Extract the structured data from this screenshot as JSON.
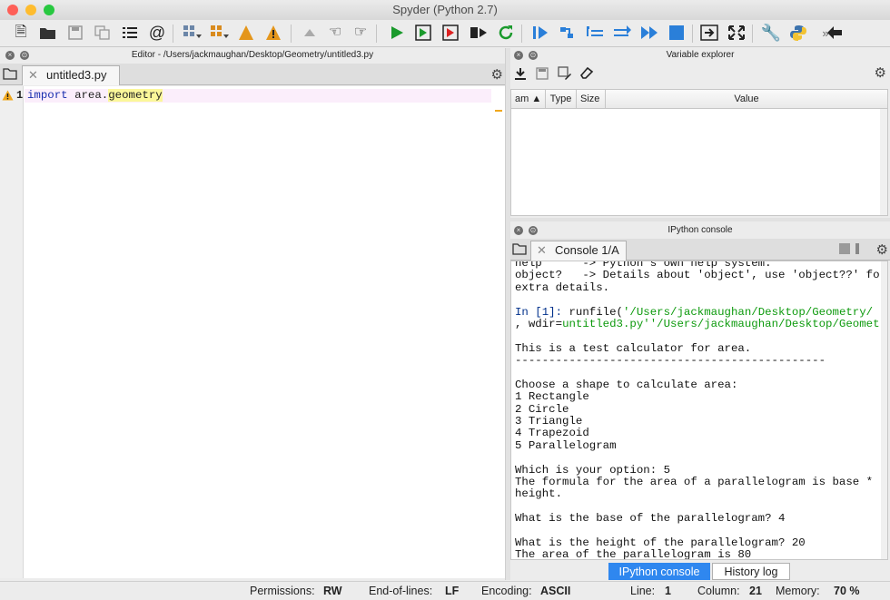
{
  "window": {
    "title": "Spyder (Python 2.7)"
  },
  "colors": {
    "close": "#fe5f57",
    "minimize": "#febc2e",
    "zoom": "#28c840",
    "tab_active": "#2f87ef"
  },
  "toolbar": {
    "icons": [
      "new-file-icon",
      "open-file-icon",
      "save-icon",
      "save-all-icon",
      "outline-icon",
      "at-icon",
      "cell-icon",
      "cell-run-icon",
      "warning-icon",
      "maximize-icon",
      "run-icon",
      "run-cell-icon",
      "run-cell-advance-icon",
      "run-selection-icon",
      "rerun-icon",
      "debug-icon",
      "step-icon",
      "step-into-icon",
      "step-return-icon",
      "continue-icon",
      "stop-icon",
      "pane-icon",
      "fullscreen-icon",
      "wrench-icon",
      "python-icon",
      "back-icon"
    ]
  },
  "editor": {
    "header": "Editor - /Users/jackmaughan/Desktop/Geometry/untitled3.py",
    "tab_label": "untitled3.py",
    "line_number": "1",
    "code_keyword": "import",
    "code_module": "area.",
    "code_highlight": "geometry"
  },
  "variable_explorer": {
    "header": "Variable explorer",
    "columns": [
      "am ▲",
      "Type",
      "Size",
      "Value"
    ]
  },
  "ipython": {
    "header": "IPython console",
    "tab_label": "Console 1/A",
    "lines": [
      {
        "t": "help      -> Python's own help system."
      },
      {
        "t": "object?   -> Details about 'object', use 'object??' for"
      },
      {
        "t": "extra details."
      },
      {
        "t": ""
      },
      {
        "p": "In [1]: ",
        "a": "runfile(",
        "s": "'/Users/jackmaughan/Desktop/Geometry/"
      },
      {
        "s": "untitled3.py'",
        "a": ", wdir=",
        "s2": "'/Users/jackmaughan/Desktop/Geometry'",
        "b": ")"
      },
      {
        "t": ""
      },
      {
        "t": "This is a test calculator for area."
      },
      {
        "t": "----------------------------------------------"
      },
      {
        "t": ""
      },
      {
        "t": "Choose a shape to calculate area:"
      },
      {
        "t": "1 Rectangle"
      },
      {
        "t": "2 Circle"
      },
      {
        "t": "3 Triangle"
      },
      {
        "t": "4 Trapezoid"
      },
      {
        "t": "5 Parallelogram"
      },
      {
        "t": ""
      },
      {
        "t": "Which is your option: 5"
      },
      {
        "t": "The formula for the area of a parallelogram is base *"
      },
      {
        "t": "height."
      },
      {
        "t": ""
      },
      {
        "t": "What is the base of the parallelogram? 4"
      },
      {
        "t": ""
      },
      {
        "t": "What is the height of the parallelogram? 20"
      },
      {
        "t": "The area of the parallelogram is 80"
      }
    ]
  },
  "bottom_tabs": {
    "ipython": "IPython console",
    "history": "History log"
  },
  "status": {
    "permissions_label": "Permissions:",
    "permissions": "RW",
    "eol_label": "End-of-lines:",
    "eol": "LF",
    "encoding_label": "Encoding:",
    "encoding": "ASCII",
    "line_label": "Line:",
    "line": "1",
    "column_label": "Column:",
    "column": "21",
    "memory_label": "Memory:",
    "memory": "70 %"
  }
}
